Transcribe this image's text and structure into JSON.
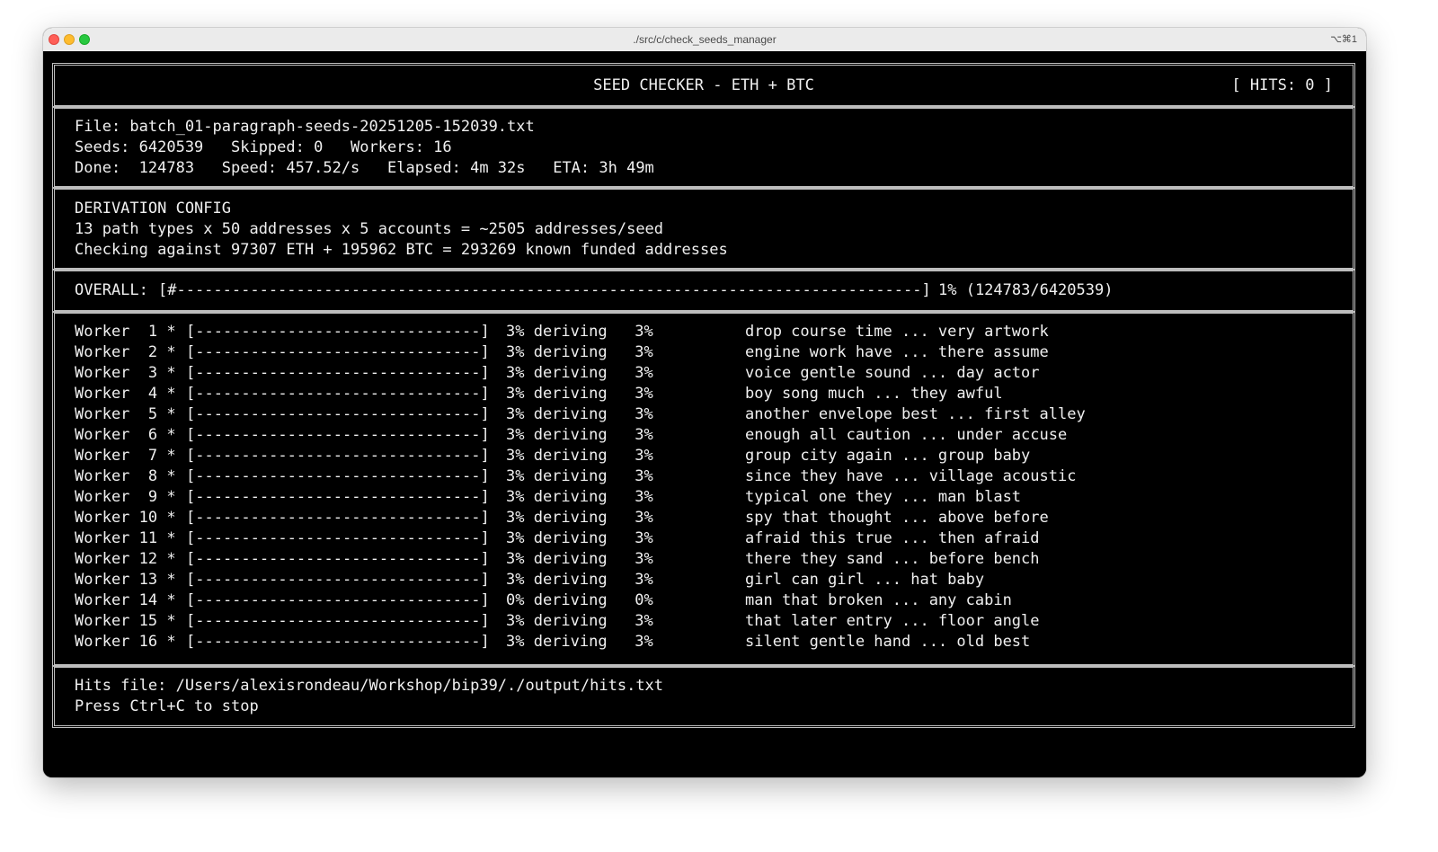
{
  "window": {
    "title": "./src/c/check_seeds_manager",
    "shortcut": "⌥⌘1"
  },
  "header": {
    "title": "SEED CHECKER - ETH + BTC",
    "hits": "[ HITS: 0 ]"
  },
  "stats": {
    "file": "File: batch_01-paragraph-seeds-20251205-152039.txt",
    "seeds_line": "Seeds: 6420539   Skipped: 0   Workers: 16",
    "done_line": "Done:  124783   Speed: 457.52/s   Elapsed: 4m 32s   ETA: 3h 49m"
  },
  "config": {
    "heading": "DERIVATION CONFIG",
    "paths_line": "13 path types x 50 addresses x 5 accounts = ~2505 addresses/seed",
    "checking_line": "Checking against 97307 ETH + 195962 BTC = 293269 known funded addresses"
  },
  "overall": {
    "label": "OVERALL:",
    "bar": "[#---------------------------------------------------------------------------------]",
    "percent": 1,
    "summary": "1% (124783/6420539)"
  },
  "workers": [
    {
      "name": "Worker  1 *",
      "bar": "[-------------------------------]",
      "status": "3% deriving   3%",
      "phrase": "drop course time ... very artwork"
    },
    {
      "name": "Worker  2 *",
      "bar": "[-------------------------------]",
      "status": "3% deriving   3%",
      "phrase": "engine work have ... there assume"
    },
    {
      "name": "Worker  3 *",
      "bar": "[-------------------------------]",
      "status": "3% deriving   3%",
      "phrase": "voice gentle sound ... day actor"
    },
    {
      "name": "Worker  4 *",
      "bar": "[-------------------------------]",
      "status": "3% deriving   3%",
      "phrase": "boy song much ... they awful"
    },
    {
      "name": "Worker  5 *",
      "bar": "[-------------------------------]",
      "status": "3% deriving   3%",
      "phrase": "another envelope best ... first alley"
    },
    {
      "name": "Worker  6 *",
      "bar": "[-------------------------------]",
      "status": "3% deriving   3%",
      "phrase": "enough all caution ... under accuse"
    },
    {
      "name": "Worker  7 *",
      "bar": "[-------------------------------]",
      "status": "3% deriving   3%",
      "phrase": "group city again ... group baby"
    },
    {
      "name": "Worker  8 *",
      "bar": "[-------------------------------]",
      "status": "3% deriving   3%",
      "phrase": "since they have ... village acoustic"
    },
    {
      "name": "Worker  9 *",
      "bar": "[-------------------------------]",
      "status": "3% deriving   3%",
      "phrase": "typical one they ... man blast"
    },
    {
      "name": "Worker 10 *",
      "bar": "[-------------------------------]",
      "status": "3% deriving   3%",
      "phrase": "spy that thought ... above before"
    },
    {
      "name": "Worker 11 *",
      "bar": "[-------------------------------]",
      "status": "3% deriving   3%",
      "phrase": "afraid this true ... then afraid"
    },
    {
      "name": "Worker 12 *",
      "bar": "[-------------------------------]",
      "status": "3% deriving   3%",
      "phrase": "there they sand ... before bench"
    },
    {
      "name": "Worker 13 *",
      "bar": "[-------------------------------]",
      "status": "3% deriving   3%",
      "phrase": "girl can girl ... hat baby"
    },
    {
      "name": "Worker 14 *",
      "bar": "[-------------------------------]",
      "status": "0% deriving   0%",
      "phrase": "man that broken ... any cabin"
    },
    {
      "name": "Worker 15 *",
      "bar": "[-------------------------------]",
      "status": "3% deriving   3%",
      "phrase": "that later entry ... floor angle"
    },
    {
      "name": "Worker 16 *",
      "bar": "[-------------------------------]",
      "status": "3% deriving   3%",
      "phrase": "silent gentle hand ... old best"
    }
  ],
  "footer": {
    "hits_file": "Hits file: /Users/alexisrondeau/Workshop/bip39/./output/hits.txt",
    "stop_hint": "Press Ctrl+C to stop"
  },
  "colors": {
    "terminal_bg": "#000000",
    "terminal_fg": "#f0f0f0",
    "border": "#bdbdbd"
  }
}
